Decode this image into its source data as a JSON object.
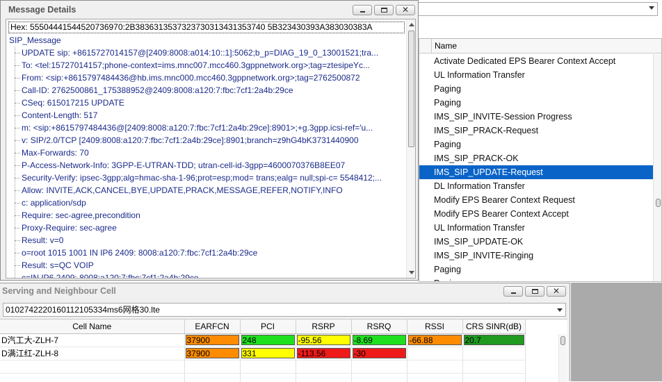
{
  "message_details": {
    "title": "Message Details",
    "hex_label": "Hex:",
    "hex_value": "55504441544520736970:2B3836313537323730313431353740 5B323430393A383030383A",
    "root": "SIP_Message",
    "fields": [
      {
        "key": "UPDATE sip:",
        "value": "+8615727014157@[2409:8008:a014:10::1]:5062;b_p=DIAG_19_0_13001521;tra..."
      },
      {
        "key": "To:",
        "value": "<tel:15727014157;phone-context=ims.mnc007.mcc460.3gppnetwork.org>;tag=ztesipeYc..."
      },
      {
        "key": "From:",
        "value": "<sip:+8615797484436@hb.ims.mnc000.mcc460.3gppnetwork.org>;tag=2762500872"
      },
      {
        "key": "Call-ID:",
        "value": "2762500861_175388952@2409:8008:a120:7:fbc:7cf1:2a4b:29ce"
      },
      {
        "key": "CSeq:",
        "value": "615017215 UPDATE"
      },
      {
        "key": "Content-Length:",
        "value": "517"
      },
      {
        "key": "m:",
        "value": "<sip:+8615797484436@[2409:8008:a120:7:fbc:7cf1:2a4b:29ce]:8901>;+g.3gpp.icsi-ref='u..."
      },
      {
        "key": "v:",
        "value": "SIP/2.0/TCP [2409:8008:a120:7:fbc:7cf1:2a4b:29ce]:8901;branch=z9hG4bK3731440900"
      },
      {
        "key": "Max-Forwards:",
        "value": "70"
      },
      {
        "key": "P-Access-Network-Info:",
        "value": "3GPP-E-UTRAN-TDD; utran-cell-id-3gpp=4600070376B8EE07"
      },
      {
        "key": "Security-Verify:",
        "value": "ipsec-3gpp;alg=hmac-sha-1-96;prot=esp;mod= trans;ealg= null;spi-c= 5548412;..."
      },
      {
        "key": "Allow:",
        "value": "INVITE,ACK,CANCEL,BYE,UPDATE,PRACK,MESSAGE,REFER,NOTIFY,INFO"
      },
      {
        "key": "c:",
        "value": "application/sdp"
      },
      {
        "key": "Require:",
        "value": "sec-agree,precondition"
      },
      {
        "key": "Proxy-Require:",
        "value": "sec-agree"
      },
      {
        "key": "Result:",
        "value": "v=0"
      },
      {
        "key": "o=root 1015 1001 IN IP6 2409:",
        "value": "8008:a120:7:fbc:7cf1:2a4b:29ce"
      },
      {
        "key": "Result:",
        "value": "s=QC VOIP"
      },
      {
        "key": "c=IN IP6 2409:",
        "value": "8008:a120:7:fbc:7cf1:2a4b:29ce"
      }
    ]
  },
  "message_list": {
    "column_header": "Name",
    "items": [
      "Activate Dedicated EPS Bearer Context Accept",
      "UL Information Transfer",
      "Paging",
      "Paging",
      "IMS_SIP_INVITE-Session Progress",
      "IMS_SIP_PRACK-Request",
      "Paging",
      "IMS_SIP_PRACK-OK",
      "IMS_SIP_UPDATE-Request",
      "DL Information Transfer",
      "Modify EPS Bearer Context Request",
      "Modify EPS Bearer Context Accept",
      "UL Information Transfer",
      "IMS_SIP_UPDATE-OK",
      "IMS_SIP_INVITE-Ringing",
      "Paging",
      "Paging"
    ],
    "selected_index": 8
  },
  "cell_window": {
    "title": "Serving and Neighbour Cell",
    "file": "0102742220160112105334ms6网格30.lte",
    "columns": [
      "Cell Name",
      "EARFCN",
      "PCI",
      "RSRP",
      "RSRQ",
      "RSSI",
      "CRS SINR(dB)"
    ],
    "rows": [
      {
        "cells": [
          "D汽工大-ZLH-7",
          "37900",
          "248",
          "-95.56",
          "-8.69",
          "-66.88",
          "20.7"
        ],
        "colors": [
          "",
          "#ff8c00",
          "#1fe01f",
          "#ffff00",
          "#1fe01f",
          "#ff8c00",
          "#1f9a1f"
        ]
      },
      {
        "cells": [
          "D满江红-ZLH-8",
          "37900",
          "331",
          "-113.56",
          "-30",
          "",
          ""
        ],
        "colors": [
          "",
          "#ff8c00",
          "#ffff00",
          "#ef1a1a",
          "#ef1a1a",
          "",
          ""
        ]
      }
    ]
  },
  "icons": {
    "minimize": "minimize-icon",
    "maximize": "maximize-icon",
    "close": "close-icon",
    "dropdown": "chevron-down-icon"
  }
}
